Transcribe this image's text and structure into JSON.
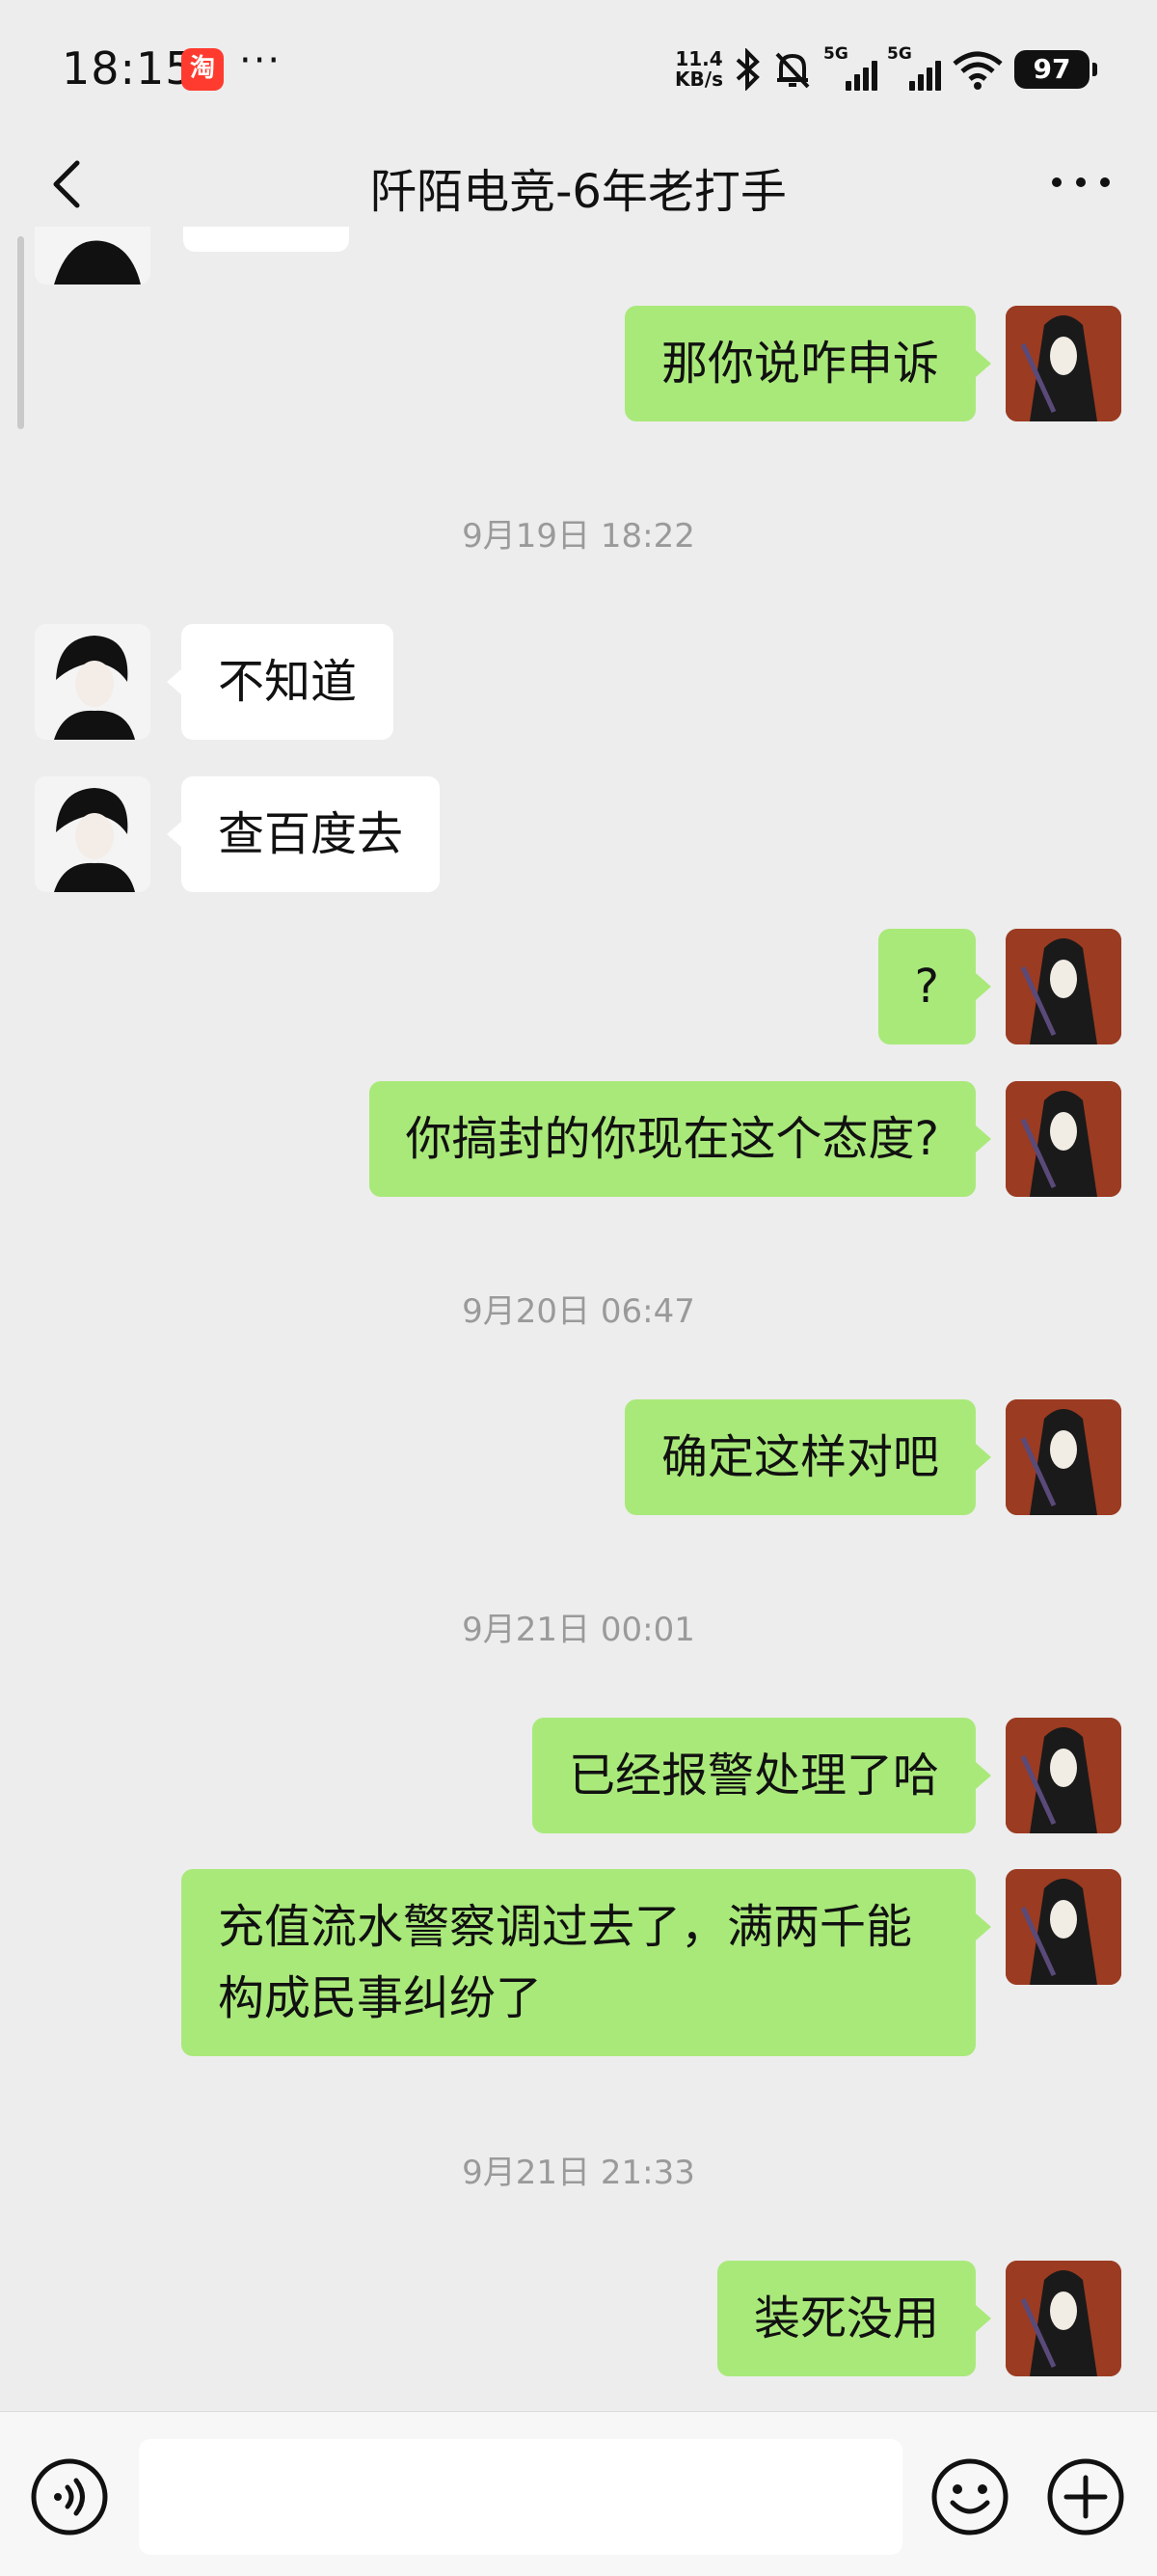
{
  "status_bar": {
    "time": "18:15",
    "app_icon_glyph": "淘",
    "more": "···",
    "net_speed_value": "11.4",
    "net_speed_unit": "KB/s",
    "signal1": "5G",
    "signal2": "5G",
    "battery": "97"
  },
  "header": {
    "title": "阡陌电竞-6年老打手"
  },
  "messages": [
    {
      "side": "self",
      "text": "那你说咋申诉"
    },
    {
      "type": "time",
      "text": "9月19日 18:22"
    },
    {
      "side": "other",
      "text": "不知道"
    },
    {
      "side": "other",
      "text": "查百度去"
    },
    {
      "side": "self",
      "text": "?"
    },
    {
      "side": "self",
      "text": "你搞封的你现在这个态度?"
    },
    {
      "type": "time",
      "text": "9月20日 06:47"
    },
    {
      "side": "self",
      "text": "确定这样对吧"
    },
    {
      "type": "time",
      "text": "9月21日 00:01"
    },
    {
      "side": "self",
      "text": "已经报警处理了哈"
    },
    {
      "side": "self",
      "text": "充值流水警察调过去了，满两千能构成民事纠纷了"
    },
    {
      "type": "time",
      "text": "9月21日 21:33"
    },
    {
      "side": "self",
      "text": "装死没用"
    }
  ],
  "colors": {
    "background": "#ededed",
    "self_bubble": "#a9e97a",
    "other_bubble": "#ffffff",
    "timestamp": "#9a9a9a"
  },
  "icons": [
    "back-arrow-icon",
    "more-icon",
    "voice-icon",
    "emoji-icon",
    "plus-icon",
    "bluetooth-icon",
    "mute-bell-icon",
    "wifi-icon"
  ]
}
